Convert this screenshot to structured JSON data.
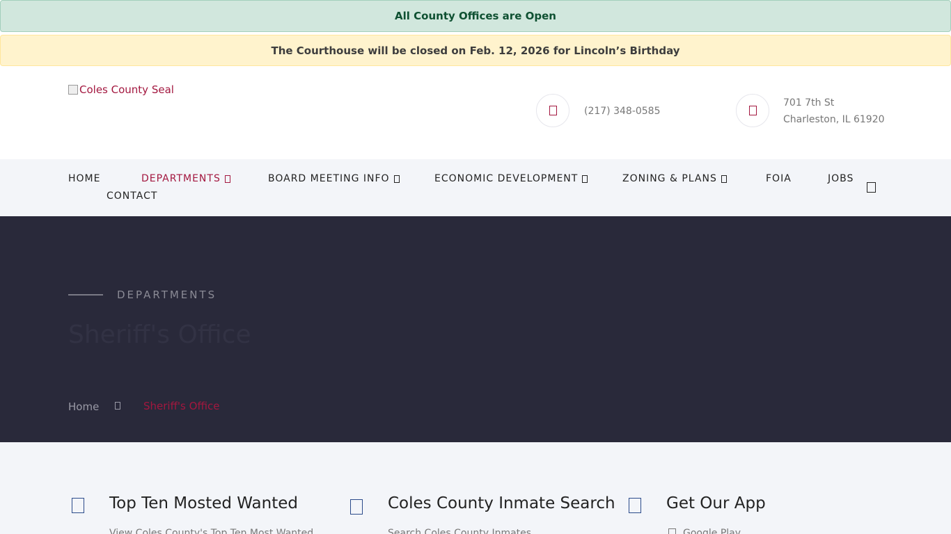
{
  "alerts": {
    "open": "All County Offices are Open",
    "closure": "The Courthouse will be closed on Feb. 12, 2026 for Lincoln’s Birthday"
  },
  "header": {
    "logo_alt": "Coles County Seal",
    "phone": "(217) 348-0585",
    "address_line1": "701 7th St",
    "address_line2": "Charleston, IL 61920"
  },
  "nav": {
    "home": "HOME",
    "departments": "DEPARTMENTS",
    "board": "BOARD MEETING INFO",
    "economic": "ECONOMIC DEVELOPMENT",
    "zoning": "ZONING & PLANS",
    "foia": "FOIA",
    "jobs": "JOBS",
    "contact": "CONTACT"
  },
  "hero": {
    "kicker": "DEPARTMENTS",
    "title": "Sheriff's Office",
    "breadcrumb_home": "Home",
    "breadcrumb_current": "Sheriff's Office"
  },
  "features": [
    {
      "title": "Top Ten Mosted Wanted",
      "desc": "View Coles County's Top Ten Most Wanted"
    },
    {
      "title": "Coles County Inmate Search",
      "desc": "Search Coles County Inmates"
    },
    {
      "title": "Get Our App",
      "desc": "Google Play"
    }
  ],
  "colors": {
    "accent": "#a3173f",
    "hero_bg": "#29293a",
    "nav_bg": "#f3f5f9"
  }
}
